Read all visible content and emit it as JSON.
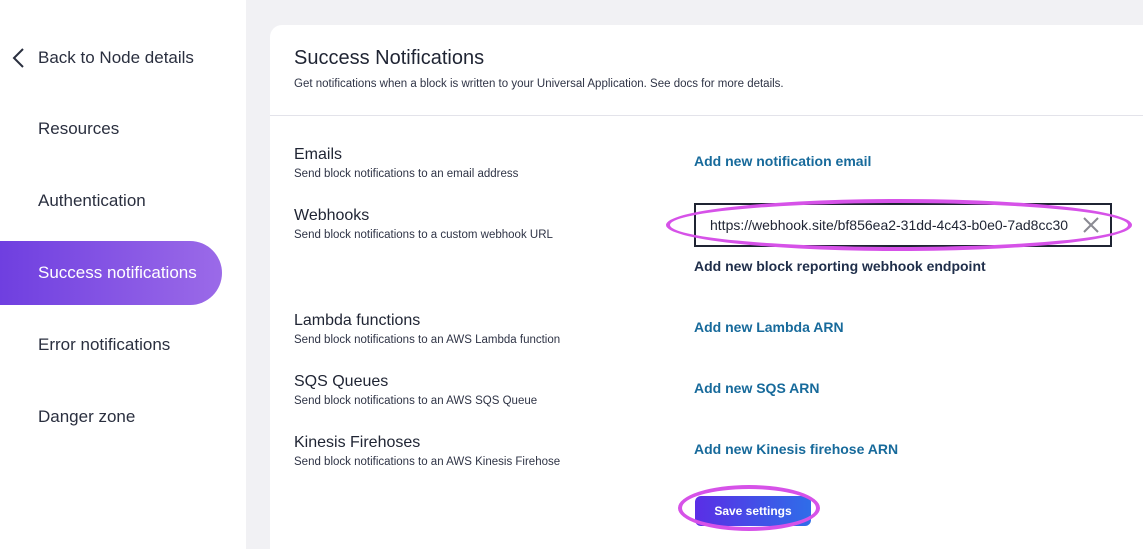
{
  "sidebar": {
    "back_label": "Back to Node details",
    "items": [
      {
        "label": "Resources"
      },
      {
        "label": "Authentication"
      },
      {
        "label": "Success notifications",
        "active": true
      },
      {
        "label": "Error notifications"
      },
      {
        "label": "Danger zone"
      }
    ]
  },
  "main": {
    "title": "Success Notifications",
    "subtitle": "Get notifications when a block is written to your Universal Application. See docs for more details.",
    "sections": {
      "emails": {
        "title": "Emails",
        "desc": "Send block notifications to an email address",
        "action": "Add new notification email"
      },
      "webhooks": {
        "title": "Webhooks",
        "desc": "Send block notifications to a custom webhook URL",
        "value": "https://webhook.site/bf856ea2-31dd-4c43-b0e0-7ad8cc30",
        "action": "Add new block reporting webhook endpoint"
      },
      "lambda": {
        "title": "Lambda functions",
        "desc": "Send block notifications to an AWS Lambda function",
        "action": "Add new Lambda ARN"
      },
      "sqs": {
        "title": "SQS Queues",
        "desc": "Send block notifications to an AWS SQS Queue",
        "action": "Add new SQS ARN"
      },
      "kinesis": {
        "title": "Kinesis Firehoses",
        "desc": "Send block notifications to an AWS Kinesis Firehose",
        "action": "Add new Kinesis firehose ARN"
      }
    },
    "save_label": "Save settings"
  },
  "colors": {
    "accent_gradient_start": "#6f3fe0",
    "accent_gradient_end": "#9b6ae8",
    "link": "#176a9b",
    "highlight": "#d652e8"
  },
  "icons": {
    "back": "chevron-left-icon",
    "clear": "close-icon"
  }
}
